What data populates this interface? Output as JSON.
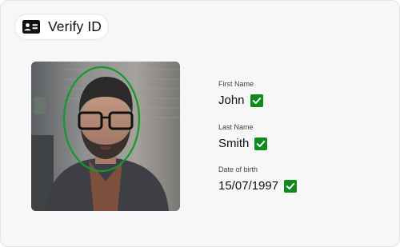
{
  "header": {
    "title": "Verify ID",
    "icon": "id-card-icon"
  },
  "photo": {
    "icon": "face-oval-guide",
    "accent": "#129a2c"
  },
  "fields": [
    {
      "label": "First Name",
      "value": "John",
      "verified": true
    },
    {
      "label": "Last Name",
      "value": "Smith",
      "verified": true
    },
    {
      "label": "Date of birth",
      "value": "15/07/1997",
      "verified": true
    }
  ],
  "colors": {
    "check": "#11891e",
    "background": "#f7f7f8"
  }
}
